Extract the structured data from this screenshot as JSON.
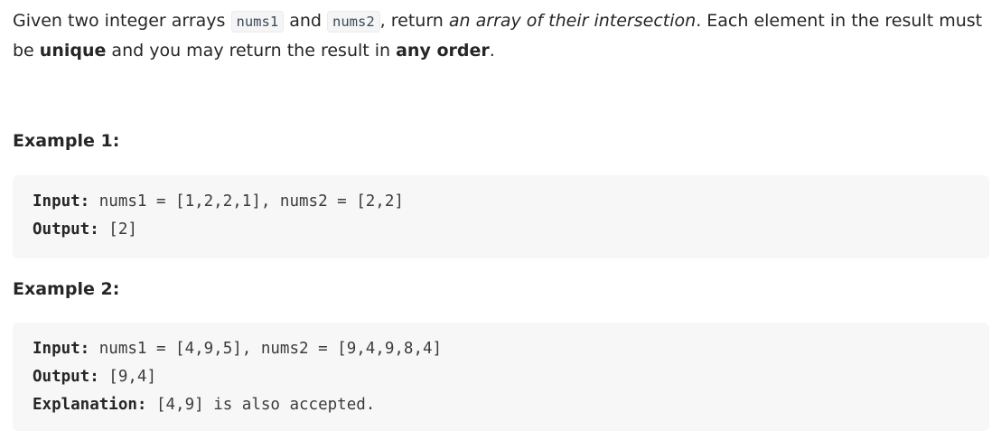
{
  "description": {
    "part1": "Given two integer arrays ",
    "code1": "nums1",
    "part2": " and ",
    "code2": "nums2",
    "part3": ", return ",
    "emphasis": "an array of their intersection",
    "part4": ". Each element in the result must be ",
    "bold1": "unique",
    "part5": " and you may return the result in ",
    "bold2": "any order",
    "part6": "."
  },
  "examples": [
    {
      "title": "Example 1:",
      "input_label": "Input:",
      "input_value": " nums1 = [1,2,2,1], nums2 = [2,2]",
      "output_label": "Output:",
      "output_value": " [2]"
    },
    {
      "title": "Example 2:",
      "input_label": "Input:",
      "input_value": " nums1 = [4,9,5], nums2 = [9,4,9,8,4]",
      "output_label": "Output:",
      "output_value": " [9,4]",
      "explanation_label": "Explanation:",
      "explanation_value": " [4,9] is also accepted."
    }
  ],
  "colors": {
    "text": "#262626",
    "code_background": "#f5f5f5",
    "example_background": "#f7f7f8"
  }
}
